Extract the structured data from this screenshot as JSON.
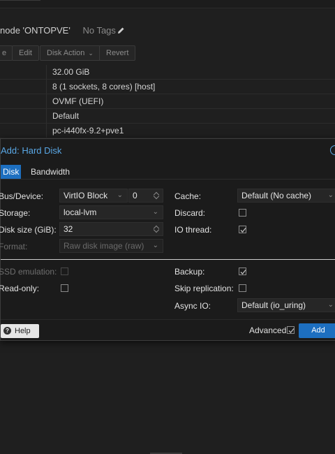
{
  "page": {
    "title_prefix": "node 'ONTOPVE'",
    "tags_label": "No Tags",
    "toolbar": [
      {
        "label": "e"
      },
      {
        "label": "Edit"
      },
      {
        "label": "Disk Action",
        "has_menu": true
      },
      {
        "label": "Revert"
      }
    ],
    "hardware_values": [
      "32.00 GiB",
      "8 (1 sockets, 8 cores) [host]",
      "OVMF (UEFI)",
      "Default",
      "pc-i440fx-9.2+pve1"
    ]
  },
  "dialog": {
    "title": "Add: Hard Disk",
    "tabs": [
      "Disk",
      "Bandwidth"
    ],
    "active_tab": "Disk",
    "bus_device": {
      "label": "Bus/Device:",
      "bus": "VirtIO Block",
      "index": "0"
    },
    "storage": {
      "label": "Storage:",
      "value": "local-lvm"
    },
    "disk_size": {
      "label": "Disk size (GiB):",
      "value": "32"
    },
    "format": {
      "label": "Format:",
      "value": "Raw disk image (raw)",
      "disabled": true
    },
    "cache": {
      "label": "Cache:",
      "value": "Default (No cache)"
    },
    "discard": {
      "label": "Discard:",
      "checked": false
    },
    "io_thread": {
      "label": "IO thread:",
      "checked": true
    },
    "ssd_emulation": {
      "label": "SSD emulation:",
      "checked": false,
      "disabled": true
    },
    "read_only": {
      "label": "Read-only:",
      "checked": false
    },
    "backup": {
      "label": "Backup:",
      "checked": true
    },
    "skip_replication": {
      "label": "Skip replication:",
      "checked": false
    },
    "async_io": {
      "label": "Async IO:",
      "value": "Default (io_uring)"
    },
    "help_label": "Help",
    "advanced_label": "Advanced",
    "advanced_checked": true,
    "add_label": "Add"
  },
  "colors": {
    "accent": "#1d6fc0",
    "title_blue": "#5aa8e6",
    "background": "#1f1f1f",
    "dialog_bg": "#1b1b1b"
  }
}
